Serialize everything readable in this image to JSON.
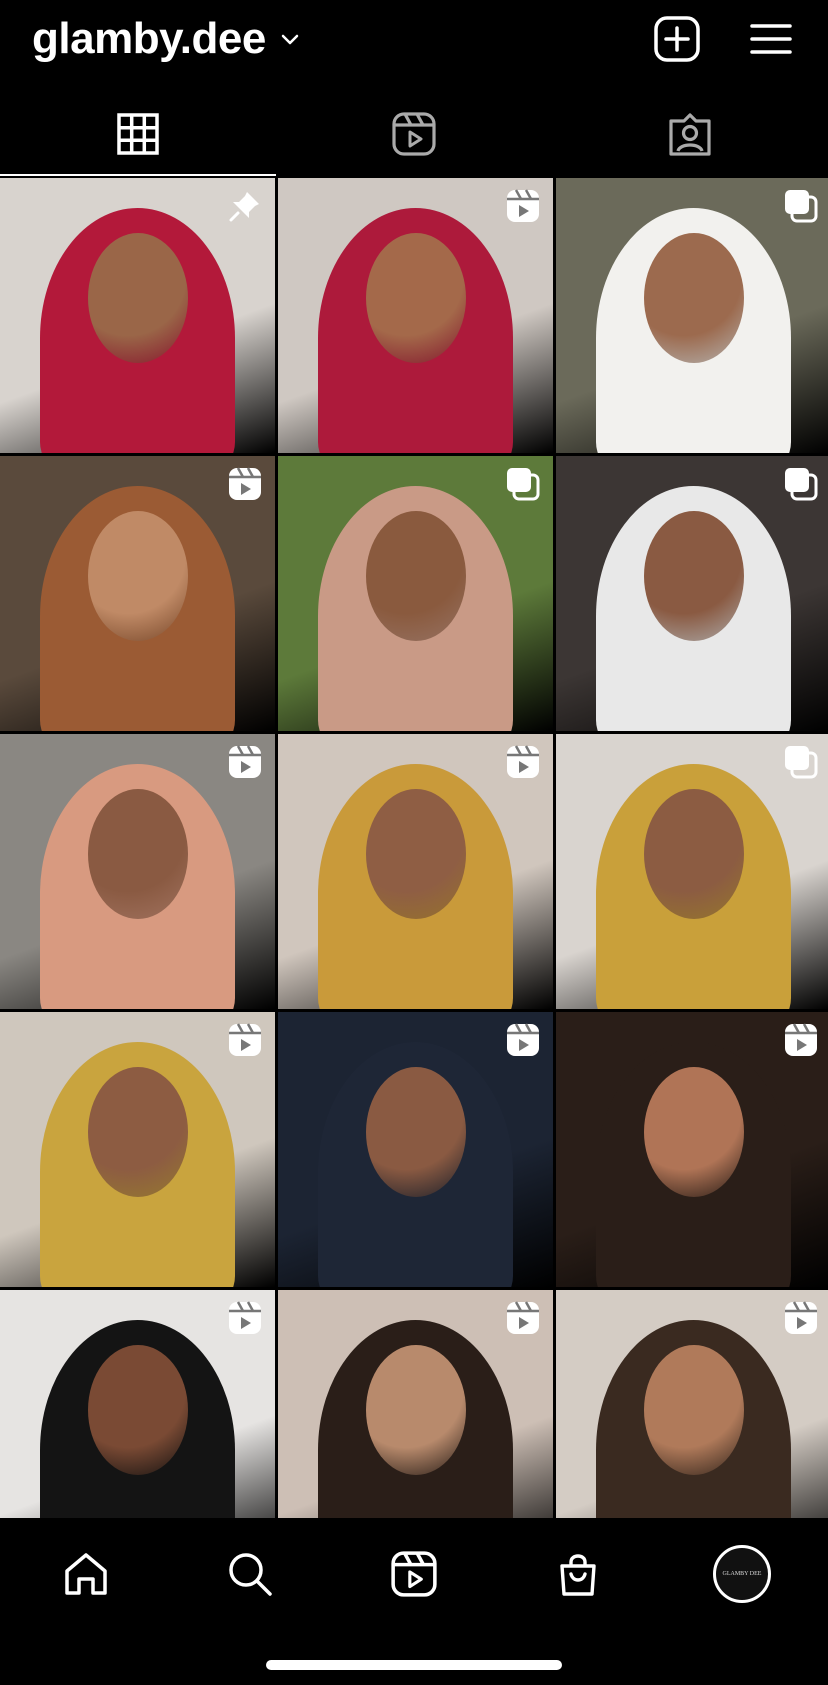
{
  "header": {
    "username": "glamby.dee",
    "dropdown_icon": "chevron-down-icon",
    "create_icon": "plus-square-icon",
    "menu_icon": "hamburger-menu-icon"
  },
  "tabs": [
    {
      "name": "posts-grid",
      "icon": "grid-icon",
      "active": true
    },
    {
      "name": "reels",
      "icon": "reels-icon",
      "active": false
    },
    {
      "name": "tagged",
      "icon": "tagged-person-icon",
      "active": false
    }
  ],
  "grid": [
    {
      "badge": "pin-icon",
      "bg": "#d8d3ce",
      "skin": "#9a6648",
      "scarf": "#b3193a",
      "desc": "red hijab portrait"
    },
    {
      "badge": "reels-icon",
      "bg": "#cfc8c2",
      "skin": "#a4694a",
      "scarf": "#ad1a3b",
      "desc": "red hijab smile"
    },
    {
      "badge": "carousel-icon",
      "bg": "#6b6a5a",
      "skin": "#9c6a4e",
      "scarf": "#f2f1ee",
      "desc": "white hijab"
    },
    {
      "badge": "reels-icon",
      "bg": "#5a4a3c",
      "skin": "#c08a66",
      "scarf": "#9b5b34",
      "desc": "long hair portrait"
    },
    {
      "badge": "carousel-icon",
      "bg": "#5d7a3a",
      "skin": "#8a5a3e",
      "scarf": "#c99a86",
      "desc": "pink hijab"
    },
    {
      "badge": "carousel-icon",
      "bg": "#3c3634",
      "skin": "#8a5a42",
      "scarf": "#e8e8e8",
      "desc": "white dress seated"
    },
    {
      "badge": "reels-icon",
      "bg": "#8a8782",
      "skin": "#8a5a42",
      "scarf": "#d89a80",
      "desc": "peach hijab"
    },
    {
      "badge": "reels-icon",
      "bg": "#d0c6bd",
      "skin": "#8f5e44",
      "scarf": "#c99a3a",
      "desc": "mustard hijab makeup"
    },
    {
      "badge": "carousel-icon",
      "bg": "#d9d4cf",
      "skin": "#8c5c42",
      "scarf": "#c9a03a",
      "desc": "mustard hijab close"
    },
    {
      "badge": "reels-icon",
      "bg": "#cfc7bd",
      "skin": "#8d5c42",
      "scarf": "#c9a43e",
      "desc": "mustard hijab collage"
    },
    {
      "badge": "reels-icon",
      "bg": "#1c2433",
      "skin": "#8a5a42",
      "scarf": "#1e2636",
      "desc": "navy hijab gold dress"
    },
    {
      "badge": "reels-icon",
      "bg": "#2a1e18",
      "skin": "#b07456",
      "scarf": "#2a1e18",
      "desc": "curly hair portrait"
    },
    {
      "badge": "reels-icon",
      "bg": "#e6e4e2",
      "skin": "#7a4a34",
      "scarf": "#141414",
      "desc": "black hijab smile"
    },
    {
      "badge": "reels-icon",
      "bg": "#cdbfb5",
      "skin": "#b88a6c",
      "scarf": "#2a1e18",
      "desc": "makeup brush"
    },
    {
      "badge": "reels-icon",
      "bg": "#d4ccc4",
      "skin": "#b07a5a",
      "scarf": "#3a2a20",
      "desc": "curly hair hoops"
    }
  ],
  "bottom_nav": [
    {
      "name": "home",
      "icon": "home-icon"
    },
    {
      "name": "search",
      "icon": "search-icon"
    },
    {
      "name": "reels",
      "icon": "reels-icon"
    },
    {
      "name": "shop",
      "icon": "shopping-bag-icon"
    },
    {
      "name": "profile",
      "icon": "profile-avatar"
    }
  ],
  "profile_avatar_text": "GLAMBY DEE"
}
